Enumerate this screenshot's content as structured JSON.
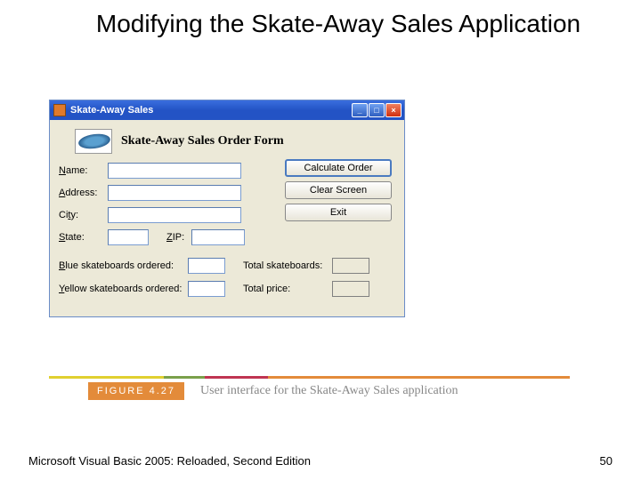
{
  "slide": {
    "title": "Modifying the Skate-Away Sales Application"
  },
  "window": {
    "title": "Skate-Away Sales",
    "form_title": "Skate-Away Sales Order Form",
    "labels": {
      "name": "Name:",
      "address": "Address:",
      "city": "City:",
      "state": "State:",
      "zip": "ZIP:",
      "blue": "Blue skateboards ordered:",
      "yellow": "Yellow skateboards ordered:",
      "total_sk": "Total skateboards:",
      "total_price": "Total price:"
    },
    "buttons": {
      "calc": "Calculate Order",
      "clear": "Clear Screen",
      "exit": "Exit"
    },
    "values": {
      "name": "",
      "address": "",
      "city": "",
      "state": "",
      "zip": "",
      "blue": "",
      "yellow": "",
      "total_sk": "",
      "total_price": ""
    }
  },
  "figure": {
    "label": "FIGURE 4.27",
    "caption": "User interface for the Skate-Away Sales application"
  },
  "footer": {
    "left": "Microsoft Visual Basic 2005: Reloaded, Second Edition",
    "right": "50"
  }
}
